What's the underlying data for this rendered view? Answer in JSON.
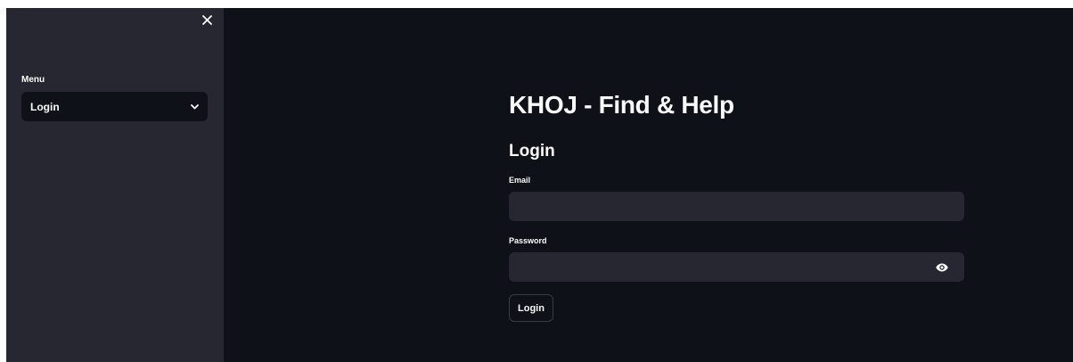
{
  "sidebar": {
    "close_icon": "close-icon",
    "menu_label": "Menu",
    "menu_selected": "Login",
    "menu_chevron_icon": "chevron-down-icon"
  },
  "main": {
    "title": "KHOJ - Find & Help",
    "section_title": "Login",
    "email_label": "Email",
    "email_value": "",
    "password_label": "Password",
    "password_value": "",
    "password_toggle_icon": "eye-icon",
    "login_button_label": "Login"
  },
  "colors": {
    "main_background": "#0e1117",
    "sidebar_background": "#262730",
    "input_background": "#262730",
    "text": "#fafafa",
    "button_border": "#3b3d45"
  }
}
